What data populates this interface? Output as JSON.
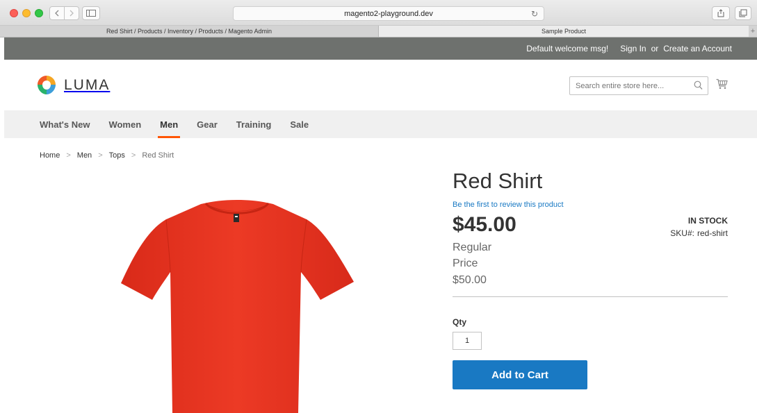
{
  "browser": {
    "url": "magento2-playground.dev",
    "tabs": [
      {
        "label": "Red Shirt / Products / Inventory / Products / Magento Admin"
      },
      {
        "label": "Sample Product"
      }
    ],
    "new_tab": "+"
  },
  "topbar": {
    "welcome": "Default welcome msg!",
    "sign_in": "Sign In",
    "or": "or",
    "create_account": "Create an Account"
  },
  "header": {
    "logo_text": "LUMA",
    "search_placeholder": "Search entire store here..."
  },
  "nav": {
    "items": [
      {
        "label": "What's New"
      },
      {
        "label": "Women"
      },
      {
        "label": "Men"
      },
      {
        "label": "Gear"
      },
      {
        "label": "Training"
      },
      {
        "label": "Sale"
      }
    ],
    "active": "Men"
  },
  "breadcrumbs": {
    "items": [
      {
        "label": "Home"
      },
      {
        "label": "Men"
      },
      {
        "label": "Tops"
      },
      {
        "label": "Red Shirt"
      }
    ],
    "separator": ">"
  },
  "product": {
    "title": "Red Shirt",
    "review_link": "Be the first to review this product",
    "price": "$45.00",
    "regular_label": "Regular Price",
    "regular_price": "$50.00",
    "stock": "IN STOCK",
    "sku_label": "SKU#:",
    "sku": "red-shirt",
    "qty_label": "Qty",
    "qty_value": "1",
    "add_to_cart": "Add to Cart",
    "image_color": "#e8321f"
  },
  "colors": {
    "accent_nav": "#ff5501",
    "button_blue": "#1979c3",
    "topbar_bg": "#6e716e"
  }
}
